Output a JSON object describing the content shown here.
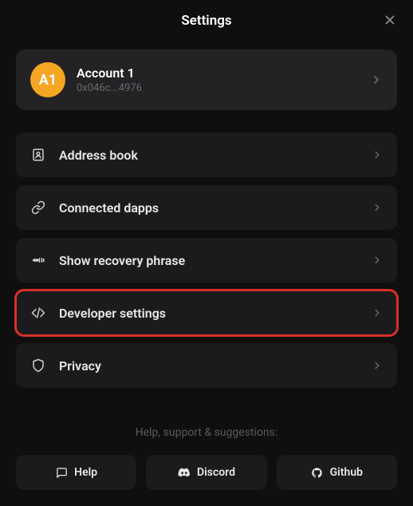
{
  "header": {
    "title": "Settings"
  },
  "account": {
    "avatar_label": "A1",
    "name": "Account 1",
    "address": "0x046c...4976"
  },
  "menu": {
    "items": [
      {
        "label": "Address book",
        "icon": "address-book-icon"
      },
      {
        "label": "Connected dapps",
        "icon": "link-icon"
      },
      {
        "label": "Show recovery phrase",
        "icon": "key-icon"
      },
      {
        "label": "Developer settings",
        "icon": "code-icon",
        "highlighted": true
      },
      {
        "label": "Privacy",
        "icon": "shield-icon"
      }
    ]
  },
  "footer": {
    "label": "Help, support & suggestions:",
    "buttons": [
      {
        "label": "Help",
        "icon": "help-icon"
      },
      {
        "label": "Discord",
        "icon": "discord-icon"
      },
      {
        "label": "Github",
        "icon": "github-icon"
      }
    ]
  }
}
